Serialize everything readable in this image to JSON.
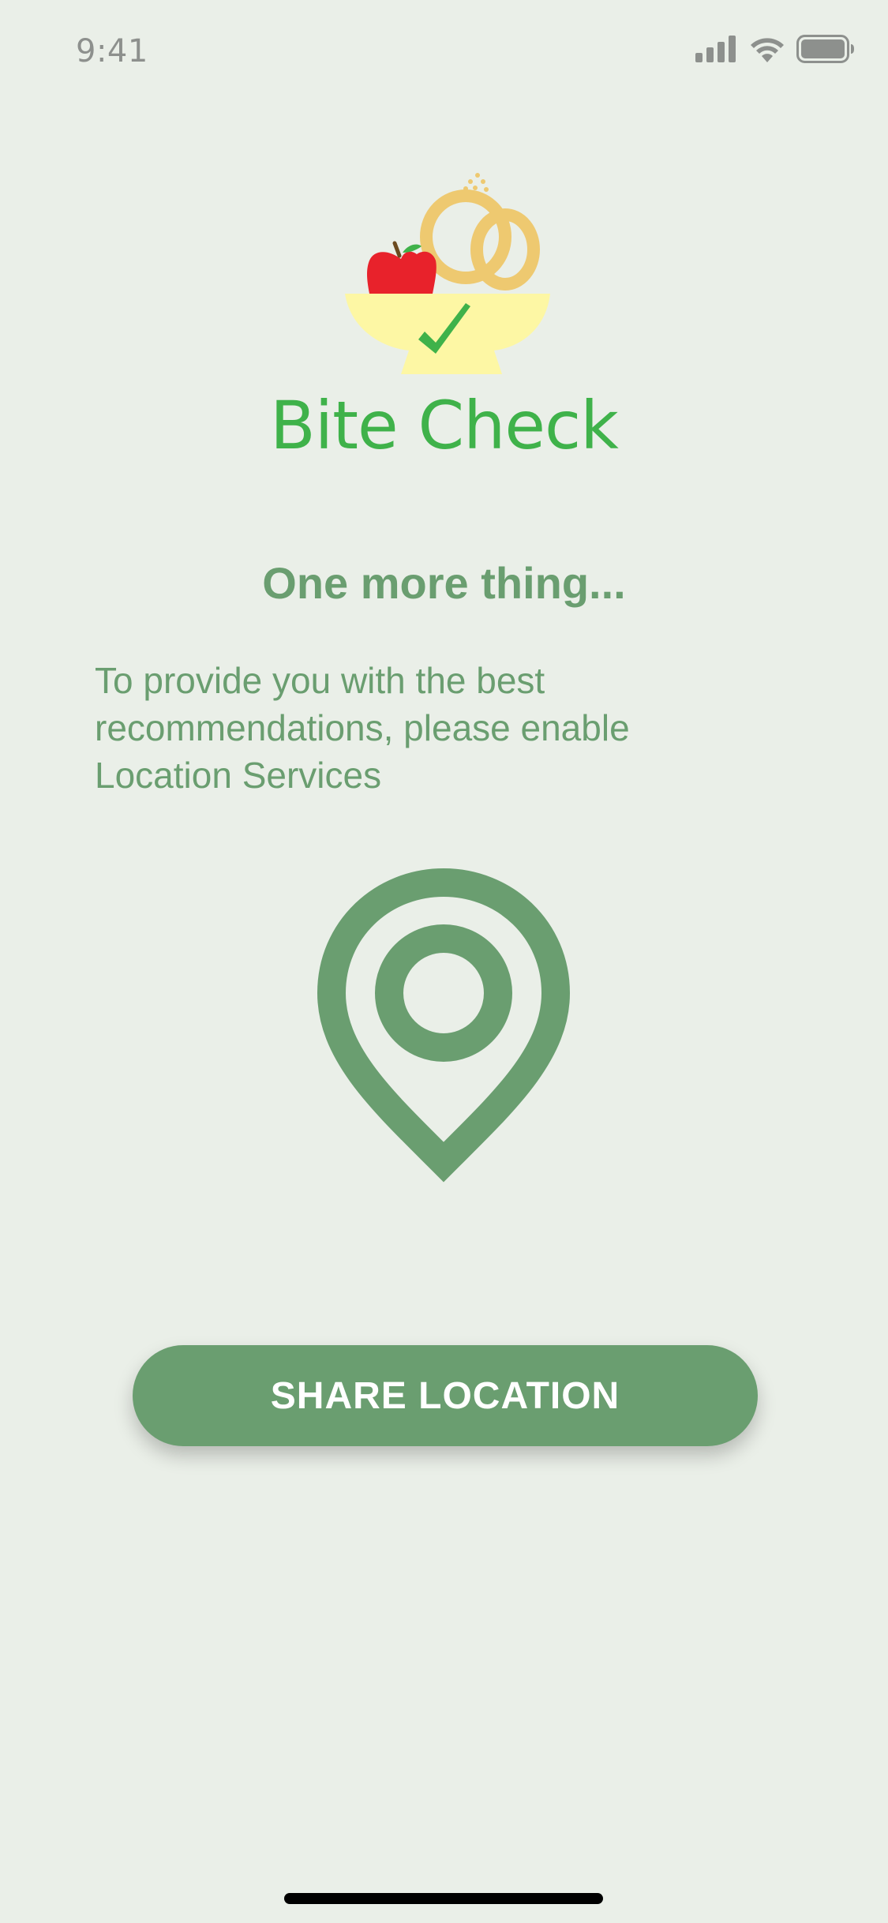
{
  "status_bar": {
    "time": "9:41",
    "icons": [
      "cellular-signal-icon",
      "wifi-icon",
      "battery-icon"
    ]
  },
  "logo": {
    "text": "Bite Check",
    "icon": "food-bowl-checkmark-logo"
  },
  "heading": "One more thing...",
  "body": "To provide you with the best recommendations, please enable Location Services",
  "illustration": {
    "icon": "location-pin-icon"
  },
  "share_button": {
    "label": "SHARE LOCATION"
  },
  "colors": {
    "background": "#eaefe8",
    "accent": "#6a9e70",
    "logo_green": "#3fb24a",
    "bowl": "#fdf7a4",
    "apple": "#e8222b",
    "pretzel": "#eec970"
  }
}
